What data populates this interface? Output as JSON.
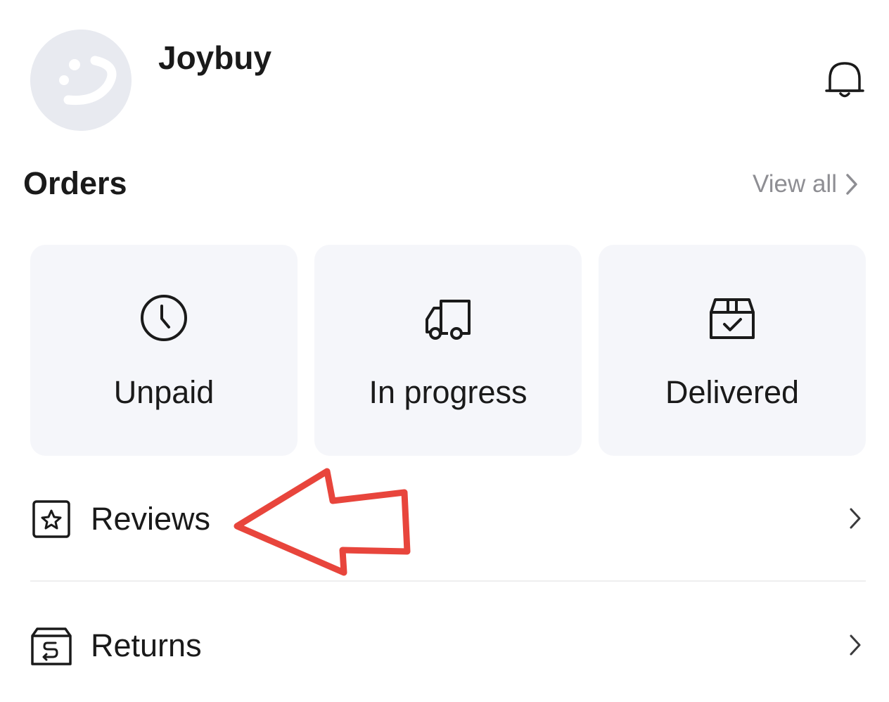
{
  "profile": {
    "username": "Joybuy"
  },
  "orders": {
    "title": "Orders",
    "view_all_label": "View all",
    "cards": [
      {
        "label": "Unpaid",
        "icon": "clock-icon"
      },
      {
        "label": "In progress",
        "icon": "truck-icon"
      },
      {
        "label": "Delivered",
        "icon": "box-check-icon"
      }
    ]
  },
  "menu": [
    {
      "label": "Reviews",
      "icon": "star-box-icon"
    },
    {
      "label": "Returns",
      "icon": "return-box-icon"
    }
  ],
  "colors": {
    "annotation_arrow": "#e8453c",
    "card_background": "#f5f6fa",
    "muted_text": "#8e8e93"
  }
}
